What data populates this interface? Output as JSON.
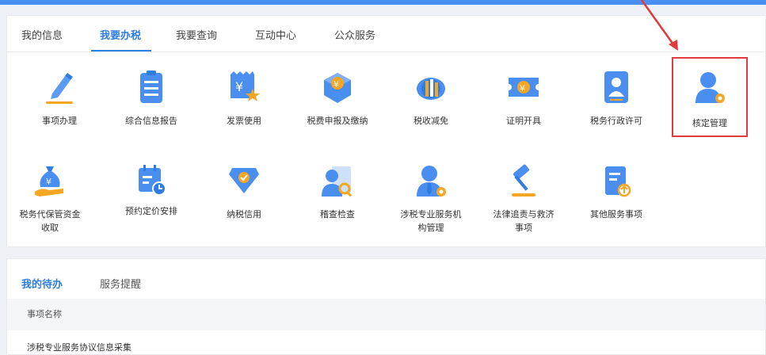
{
  "tabs": [
    "我的信息",
    "我要办税",
    "我要查询",
    "互动中心",
    "公众服务"
  ],
  "active_tab": "我要办税",
  "services": [
    {
      "label": "事项办理",
      "icon": "pen-icon"
    },
    {
      "label": "综合信息报告",
      "icon": "report-icon"
    },
    {
      "label": "发票使用",
      "icon": "invoice-icon"
    },
    {
      "label": "税费申报及缴纳",
      "icon": "tax-box-icon"
    },
    {
      "label": "税收减免",
      "icon": "coins-icon"
    },
    {
      "label": "证明开具",
      "icon": "ticket-icon"
    },
    {
      "label": "税务行政许可",
      "icon": "license-icon"
    },
    {
      "label": "核定管理",
      "icon": "user-gear-icon"
    },
    {
      "label": "税务代保管资金收取",
      "icon": "money-bag-icon"
    },
    {
      "label": "预约定价安排",
      "icon": "calendar-icon"
    },
    {
      "label": "纳税信用",
      "icon": "credit-icon"
    },
    {
      "label": "稽查检查",
      "icon": "inspect-icon"
    },
    {
      "label": "涉税专业服务机构管理",
      "icon": "agency-icon"
    },
    {
      "label": "法律追责与救济事项",
      "icon": "gavel-icon"
    },
    {
      "label": "其他服务事项",
      "icon": "other-doc-icon"
    }
  ],
  "bottom": {
    "tabs": [
      "我的待办",
      "服务提醒"
    ],
    "active_tab": "我的待办",
    "column_header": "事项名称",
    "rows": [
      "涉税专业服务协议信息采集"
    ]
  },
  "colors": {
    "accent": "#2f7de1",
    "highlight": "#e03a3a",
    "icon_orange": "#f5a623"
  }
}
